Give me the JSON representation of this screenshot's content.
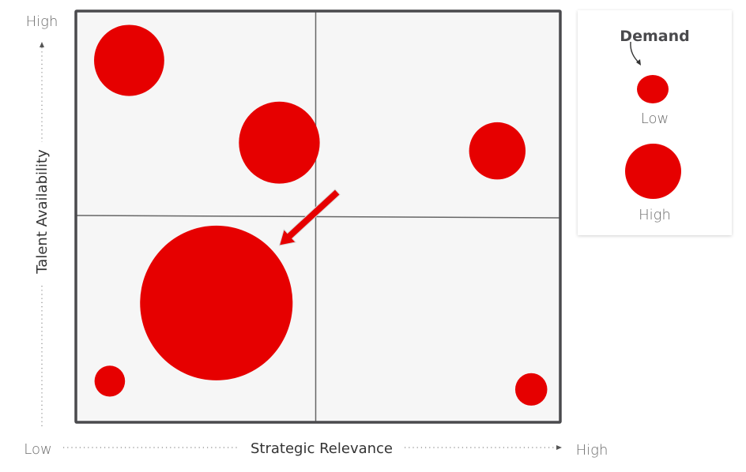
{
  "chart_data": {
    "type": "scatter",
    "subtype": "bubble-quadrant",
    "title": "",
    "xlabel": "Strategic Relevance",
    "ylabel": "Talent Availability",
    "xlim": [
      0,
      1
    ],
    "ylim": [
      0,
      1
    ],
    "x_tick_labels": {
      "low": "Low",
      "high": "High"
    },
    "y_tick_labels": {
      "low": "Low",
      "high": "High"
    },
    "quadrant_dividers": {
      "x": 0.5,
      "y": 0.5
    },
    "grid": false,
    "size_variable": "Demand",
    "points": [
      {
        "x": 0.11,
        "y": 0.88,
        "size": 0.46
      },
      {
        "x": 0.42,
        "y": 0.68,
        "size": 0.53
      },
      {
        "x": 0.87,
        "y": 0.66,
        "size": 0.37
      },
      {
        "x": 0.29,
        "y": 0.29,
        "size": 1.0
      },
      {
        "x": 0.07,
        "y": 0.1,
        "size": 0.2
      },
      {
        "x": 0.94,
        "y": 0.08,
        "size": 0.21
      }
    ],
    "annotation": {
      "type": "arrow",
      "from": {
        "x": 0.54,
        "y": 0.56
      },
      "to": {
        "x": 0.42,
        "y": 0.43
      },
      "points_to_point_index": 3
    },
    "legend": {
      "title": "Demand",
      "placement": "top-right",
      "entries": [
        {
          "label": "Low",
          "size": 0.2
        },
        {
          "label": "High",
          "size": 0.36
        }
      ]
    },
    "colors": {
      "bubble": "#e60000",
      "frame": "#4a4a4d",
      "divider": "#666666",
      "plot_background": "#f6f6f6"
    }
  }
}
